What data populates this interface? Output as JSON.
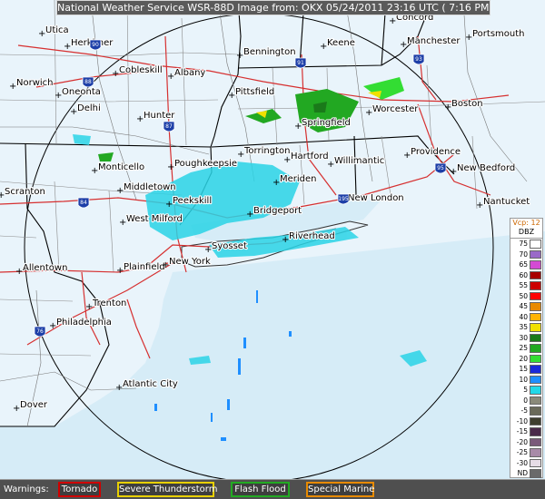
{
  "header": {
    "title": "National Weather Service WSR-88D Image from: OKX 05/24/2011 23:16 UTC ( 7:16 PM EDT)"
  },
  "cities": [
    {
      "name": "Utica"
    },
    {
      "name": "Herkimer"
    },
    {
      "name": "Concord"
    },
    {
      "name": "Portsmouth"
    },
    {
      "name": "Bennington"
    },
    {
      "name": "Keene"
    },
    {
      "name": "Manchester"
    },
    {
      "name": "Cobleskill"
    },
    {
      "name": "Albany"
    },
    {
      "name": "Norwich"
    },
    {
      "name": "Oneonta"
    },
    {
      "name": "Delhi"
    },
    {
      "name": "Pittsfield"
    },
    {
      "name": "Worcester"
    },
    {
      "name": "Boston"
    },
    {
      "name": "Hunter"
    },
    {
      "name": "Springfield"
    },
    {
      "name": "Torrington"
    },
    {
      "name": "Hartford"
    },
    {
      "name": "Providence"
    },
    {
      "name": "Monticello"
    },
    {
      "name": "Poughkeepsie"
    },
    {
      "name": "Willimantic"
    },
    {
      "name": "New Bedford"
    },
    {
      "name": "Middletown"
    },
    {
      "name": "Meriden"
    },
    {
      "name": "Scranton"
    },
    {
      "name": "Peekskill"
    },
    {
      "name": "New London"
    },
    {
      "name": "Nantucket"
    },
    {
      "name": "West Milford"
    },
    {
      "name": "Bridgeport"
    },
    {
      "name": "Riverhead"
    },
    {
      "name": "Syosset"
    },
    {
      "name": "Allentown"
    },
    {
      "name": "Plainfield"
    },
    {
      "name": "New York"
    },
    {
      "name": "Trenton"
    },
    {
      "name": "Philadelphia"
    },
    {
      "name": "Atlantic City"
    },
    {
      "name": "Dover"
    }
  ],
  "highway_shields": [
    "90",
    "88",
    "87",
    "91",
    "93",
    "95",
    "84",
    "195",
    "76"
  ],
  "legend": {
    "vcp_label": "Vcp: 12",
    "unit_label": "DBZ",
    "levels": [
      {
        "label": "75",
        "color": "#ffffff"
      },
      {
        "label": "70",
        "color": "#9a6ac8"
      },
      {
        "label": "65",
        "color": "#d44ad4"
      },
      {
        "label": "60",
        "color": "#a80000"
      },
      {
        "label": "55",
        "color": "#cc0000"
      },
      {
        "label": "50",
        "color": "#ff0000"
      },
      {
        "label": "45",
        "color": "#e88a00"
      },
      {
        "label": "40",
        "color": "#ffb400"
      },
      {
        "label": "35",
        "color": "#f0e000"
      },
      {
        "label": "30",
        "color": "#1a7a1a"
      },
      {
        "label": "25",
        "color": "#22a822"
      },
      {
        "label": "20",
        "color": "#33dd33"
      },
      {
        "label": "15",
        "color": "#1a2ad8"
      },
      {
        "label": "10",
        "color": "#1f8fff"
      },
      {
        "label": "5",
        "color": "#22d8e8"
      },
      {
        "label": "0",
        "color": "#8a8a7a"
      },
      {
        "label": "-5",
        "color": "#6a6a5a"
      },
      {
        "label": "-10",
        "color": "#3e3e2e"
      },
      {
        "label": "-15",
        "color": "#4a2a4a"
      },
      {
        "label": "-20",
        "color": "#7a5a7a"
      },
      {
        "label": "-25",
        "color": "#a88aa8"
      },
      {
        "label": "-30",
        "color": "#e6dce6"
      },
      {
        "label": "ND",
        "color": "#6a6a6a"
      }
    ]
  },
  "warnings": {
    "label": "Warnings:",
    "items": [
      {
        "label": "Tornado",
        "color": "#d00000"
      },
      {
        "label": "Severe Thunderstorm",
        "color": "#e8d000"
      },
      {
        "label": "Flash Flood",
        "color": "#22aa22"
      },
      {
        "label": "Special Marine",
        "color": "#e88a00"
      }
    ]
  },
  "colors": {
    "land": "#e9f4fb",
    "water": "#b9dcee",
    "borders": "#000000",
    "roads": "#d63030",
    "light_echo": "#2ad4e6",
    "moderate_echo": "#22a822"
  }
}
